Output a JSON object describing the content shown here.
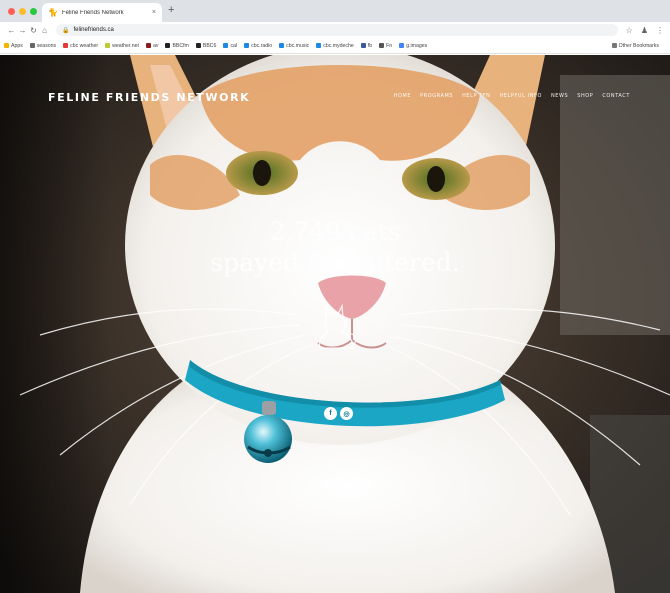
{
  "browser": {
    "tab_title": "Feline Friends Network",
    "tab_close": "×",
    "new_tab": "+",
    "url": "felinefriends.ca",
    "bookmarks": [
      {
        "label": "Apps",
        "color": "#f4b400"
      },
      {
        "label": "seasons",
        "color": "#666666"
      },
      {
        "label": "cbc weather",
        "color": "#e53935"
      },
      {
        "label": "weather.net",
        "color": "#c0ca33"
      },
      {
        "label": "av",
        "color": "#8e1b1b"
      },
      {
        "label": "BBCfm",
        "color": "#222222"
      },
      {
        "label": "BBC6",
        "color": "#222222"
      },
      {
        "label": "cal",
        "color": "#1e88e5"
      },
      {
        "label": "cbc.radio",
        "color": "#1e88e5"
      },
      {
        "label": "cbc.music",
        "color": "#1e88e5"
      },
      {
        "label": "cbc.mydeche",
        "color": "#1e88e5"
      },
      {
        "label": "fb",
        "color": "#3b5998"
      },
      {
        "label": "Fn",
        "color": "#555555"
      },
      {
        "label": "g.images",
        "color": "#4285f4"
      }
    ],
    "other_bookmarks": "Other Bookmarks"
  },
  "site": {
    "logo": "FELINE FRIENDS NETWORK",
    "nav": [
      "HOME",
      "PROGRAMS",
      "HELP FFN",
      "HELPFUL INFO",
      "NEWS",
      "SHOP",
      "CONTACT"
    ],
    "headline_line1": "2,749 cats",
    "headline_line2": "spayed & neutered.",
    "social": [
      {
        "icon": "facebook-icon",
        "glyph": "f"
      },
      {
        "icon": "instagram-icon",
        "glyph": "◎"
      }
    ]
  },
  "colors": {
    "collar": "#1aa6c4",
    "accent": "#0d7a8e"
  }
}
